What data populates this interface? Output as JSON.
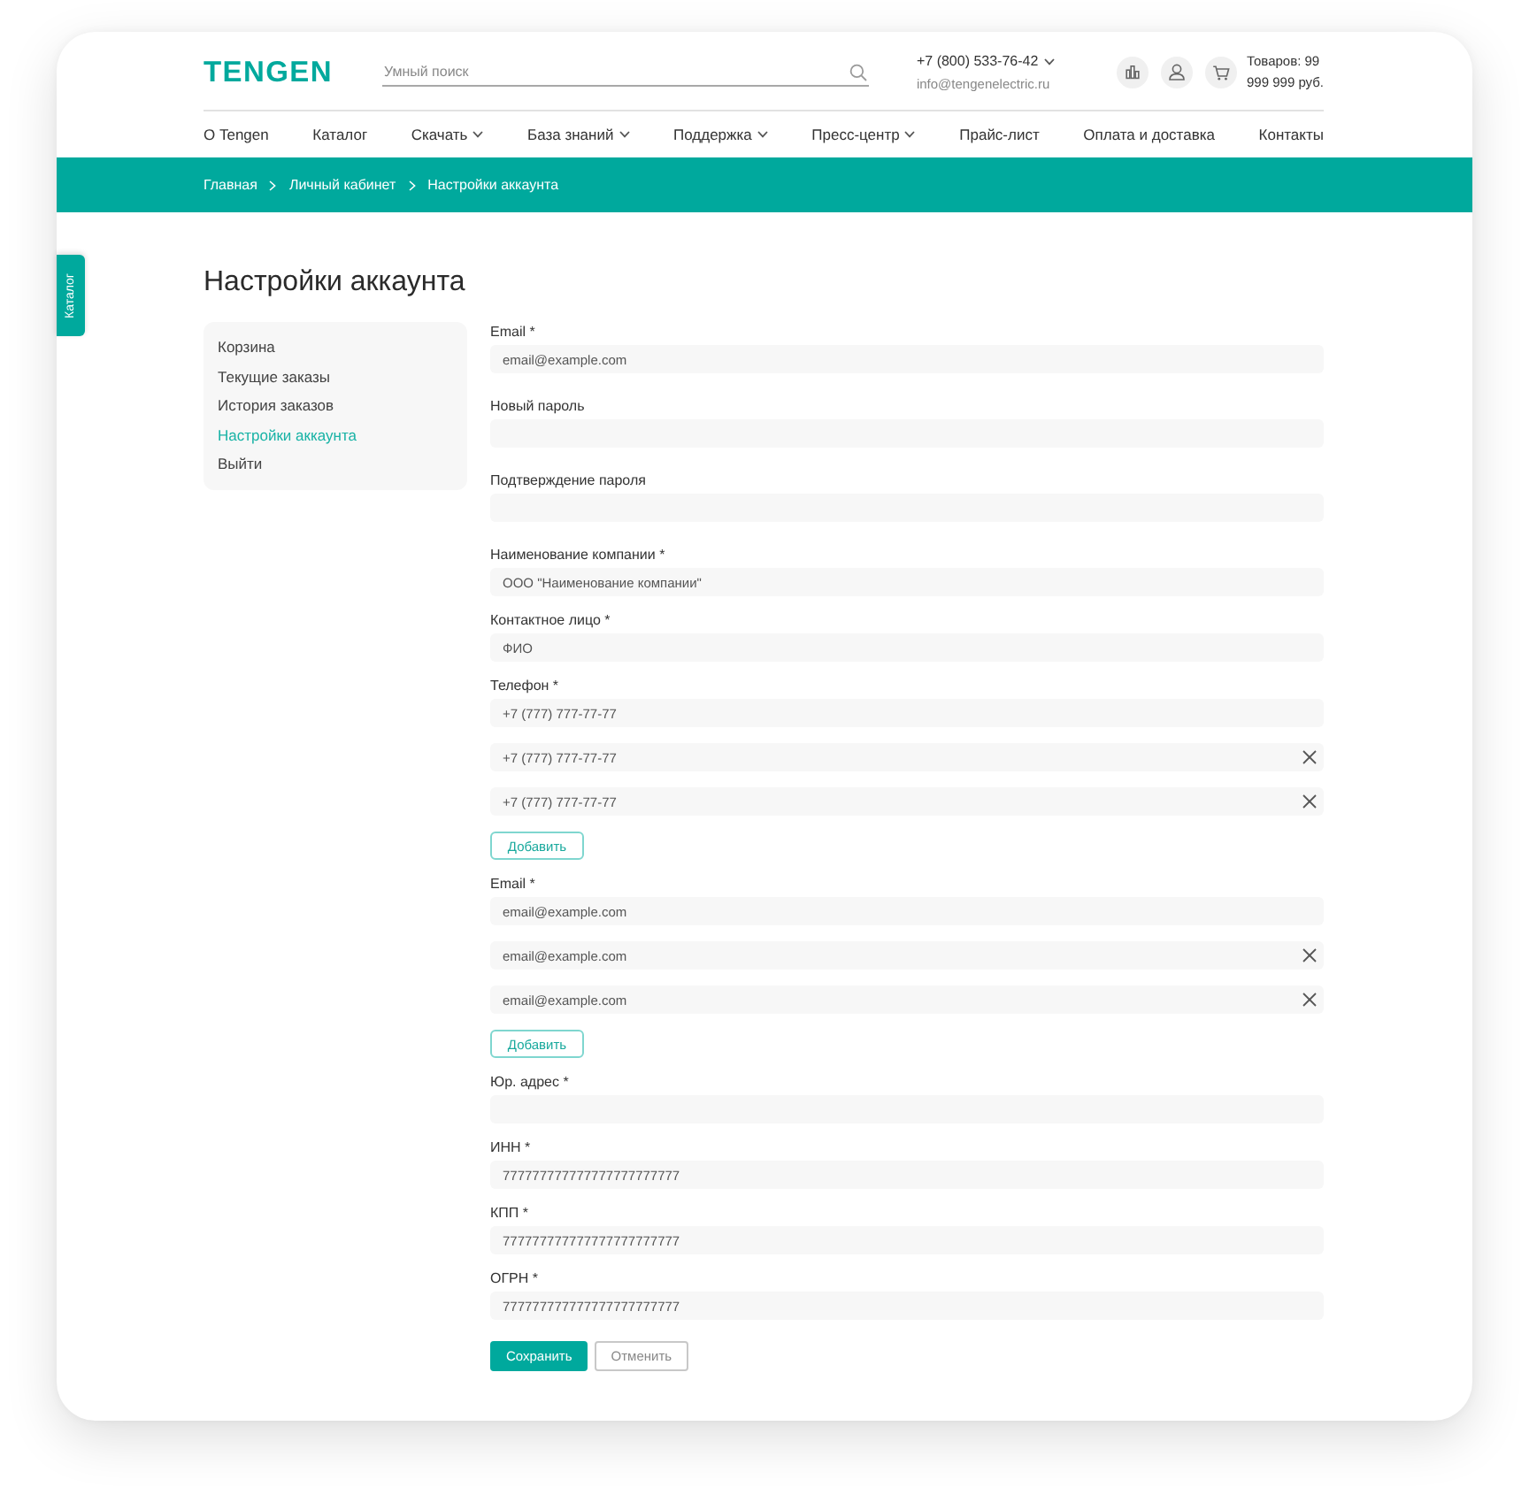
{
  "header": {
    "logo": "TENGEN",
    "search": {
      "placeholder": "Умный поиск"
    },
    "phone": "+7 (800) 533-76-42",
    "email": "info@tengenelectric.ru",
    "cart_count": "Товаров: 99",
    "cart_total": "999 999 руб."
  },
  "nav": [
    {
      "label": "О Tengen",
      "dropdown": false
    },
    {
      "label": "Каталог",
      "dropdown": false
    },
    {
      "label": "Скачать",
      "dropdown": true
    },
    {
      "label": "База знаний",
      "dropdown": true
    },
    {
      "label": "Поддержка",
      "dropdown": true
    },
    {
      "label": "Пресс-центр",
      "dropdown": true
    },
    {
      "label": "Прайс-лист",
      "dropdown": false
    },
    {
      "label": "Оплата и доставка",
      "dropdown": false
    },
    {
      "label": "Контакты",
      "dropdown": false
    }
  ],
  "breadcrumbs": [
    "Главная",
    "Личный кабинет",
    "Настройки аккаунта"
  ],
  "side_tab": "Каталог",
  "title": "Настройки аккаунта",
  "sidebar": {
    "items": [
      {
        "label": "Корзина",
        "selected": false
      },
      {
        "label": "Текущие заказы",
        "selected": false
      },
      {
        "label": "История заказов",
        "selected": false
      },
      {
        "label": "Настройки аккаунта",
        "selected": true
      },
      {
        "label": "Выйти",
        "selected": false
      }
    ]
  },
  "form": {
    "account_fields": [
      {
        "label": "Email *",
        "inputs": [
          {
            "value": "email@example.com",
            "removable": false
          }
        ]
      },
      {
        "label": "Новый пароль",
        "inputs": [
          {
            "removable": false
          }
        ]
      },
      {
        "label": "Подтверждение пароля",
        "inputs": [
          {
            "removable": false
          }
        ]
      }
    ],
    "company_fields": [
      {
        "label": "Наименование компании *",
        "inputs": [
          {
            "value": "ООО \"Наименование компании\"",
            "removable": false
          }
        ]
      },
      {
        "label": "Контактное лицо *",
        "inputs": [
          {
            "value": "ФИО",
            "removable": false
          }
        ]
      },
      {
        "label": "Телефон *",
        "inputs": [
          {
            "value": "+7 (777) 777-77-77",
            "removable": false
          },
          {
            "value": "+7 (777) 777-77-77",
            "removable": true
          },
          {
            "value": "+7 (777) 777-77-77",
            "removable": true
          }
        ],
        "add_button": "Добавить"
      },
      {
        "label": "Email *",
        "inputs": [
          {
            "value": "email@example.com",
            "removable": false
          },
          {
            "value": "email@example.com",
            "removable": true
          },
          {
            "value": "email@example.com",
            "removable": true
          }
        ],
        "add_button": "Добавить"
      },
      {
        "label": "Юр. адрес *",
        "inputs": [
          {
            "removable": false
          }
        ]
      },
      {
        "label": "ИНН *",
        "inputs": [
          {
            "value": "777777777777777777777777",
            "removable": false
          }
        ]
      },
      {
        "label": "КПП *",
        "inputs": [
          {
            "value": "777777777777777777777777",
            "removable": false
          }
        ]
      },
      {
        "label": "ОГРН *",
        "inputs": [
          {
            "value": "777777777777777777777777",
            "removable": false
          }
        ]
      }
    ],
    "buttons": [
      {
        "label": "Сохранить",
        "kind": "primary"
      },
      {
        "label": "Отменить",
        "kind": "secondary"
      }
    ]
  }
}
